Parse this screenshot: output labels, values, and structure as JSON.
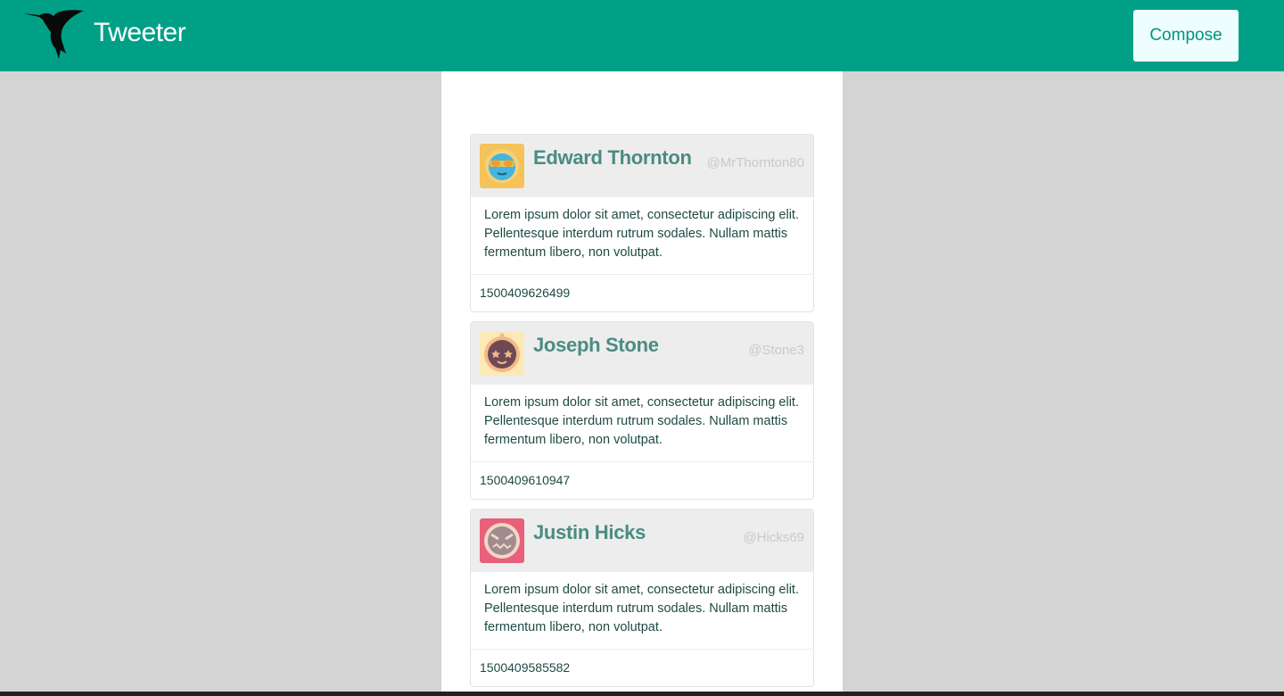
{
  "app": {
    "brand": "Tweeter",
    "compose_label": "Compose"
  },
  "colors": {
    "nav": "#00a087",
    "accent": "#4a8c82",
    "background": "#d4d4d4"
  },
  "tweets": [
    {
      "name": "Edward Thornton",
      "handle": "@MrThornton80",
      "text": "Lorem ipsum dolor sit amet, consectetur adipiscing elit. Pellentesque interdum rutrum sodales. Nullam mattis fermentum libero, non volutpat.",
      "timestamp": "1500409626499",
      "avatar": "sunglasses-face-icon"
    },
    {
      "name": "Joseph Stone",
      "handle": "@Stone3",
      "text": "Lorem ipsum dolor sit amet, consectetur adipiscing elit. Pellentesque interdum rutrum sodales. Nullam mattis fermentum libero, non volutpat.",
      "timestamp": "1500409610947",
      "avatar": "star-eyes-face-icon"
    },
    {
      "name": "Justin Hicks",
      "handle": "@Hicks69",
      "text": "Lorem ipsum dolor sit amet, consectetur adipiscing elit. Pellentesque interdum rutrum sodales. Nullam mattis fermentum libero, non volutpat.",
      "timestamp": "1500409585582",
      "avatar": "angry-face-icon"
    }
  ]
}
